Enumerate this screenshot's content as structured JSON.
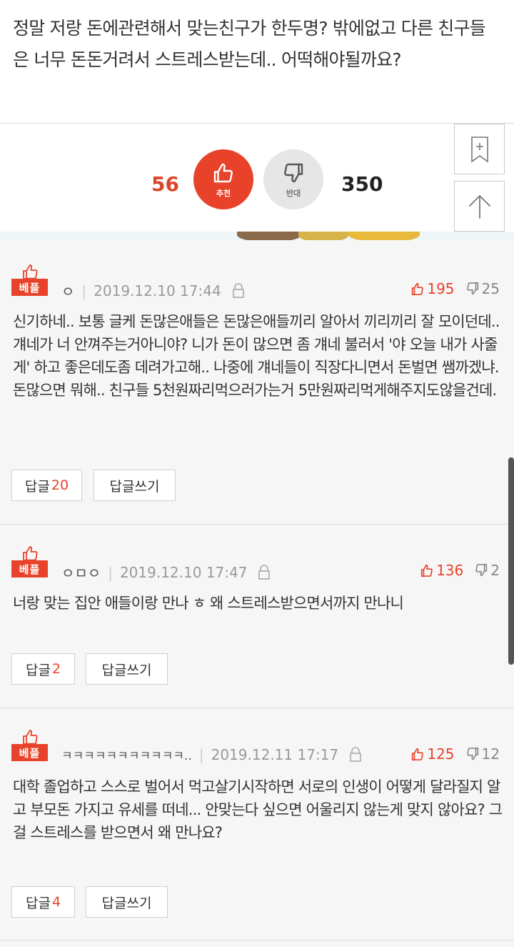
{
  "post": {
    "text": "정말 저랑 돈에관련해서 맞는친구가 한두명? 밖에없고 다른 친구들은 너무 돈돈거려서 스트레스받는데.. 어떡해야될까요?"
  },
  "vote": {
    "up_count": "56",
    "up_label": "추천",
    "down_label": "반대",
    "down_count": "350"
  },
  "side": {
    "bookmark_icon": "bookmark-plus-icon",
    "top_icon": "arrow-up-icon"
  },
  "colors": {
    "accent": "#e8432a",
    "comment_bg": "#f6f6f6"
  },
  "comments": [
    {
      "badge": "베플",
      "author": "ㅇ",
      "date": "2019.12.10 17:44",
      "up": "195",
      "down": "25",
      "text": "신기하네.. 보통 글케 돈많은애들은 돈많은애들끼리 알아서 끼리끼리 잘 모이던데.. 걔네가 너 안껴주는거아니야? 니가 돈이 많으면 좀 걔네 불러서 '야 오늘 내가 사줄게' 하고 좋은데도좀 데려가고해.. 나중에 걔네들이 직장다니면서 돈벌면 쌤까겠냐. 돈많으면 뭐해.. 친구들 5천원짜리먹으러가는거 5만원짜리먹게해주지도않을건데.",
      "reply_label": "답글",
      "reply_count": "20",
      "write_label": "답글쓰기"
    },
    {
      "badge": "베플",
      "author": "ㅇㅁㅇ",
      "date": "2019.12.10 17:47",
      "up": "136",
      "down": "2",
      "text": "너랑 맞는 집안 애들이랑 만나 ㅎ 왜 스트레스받으면서까지 만나니",
      "reply_label": "답글",
      "reply_count": "2",
      "write_label": "답글쓰기"
    },
    {
      "badge": "베플",
      "author": "ㅋㅋㅋㅋㅋㅋㅋㅋㅋㅋㅋ..",
      "date": "2019.12.11 17:17",
      "up": "125",
      "down": "12",
      "text": "대학 졸업하고 스스로 벌어서 먹고살기시작하면 서로의 인생이 어떻게 달라질지 알고 부모돈 가지고 유세를 떠네... 안맞는다 싶으면 어울리지 않는게 맞지 않아요? 그걸 스트레스를 받으면서 왜 만나요?",
      "reply_label": "답글",
      "reply_count": "4",
      "write_label": "답글쓰기"
    }
  ]
}
